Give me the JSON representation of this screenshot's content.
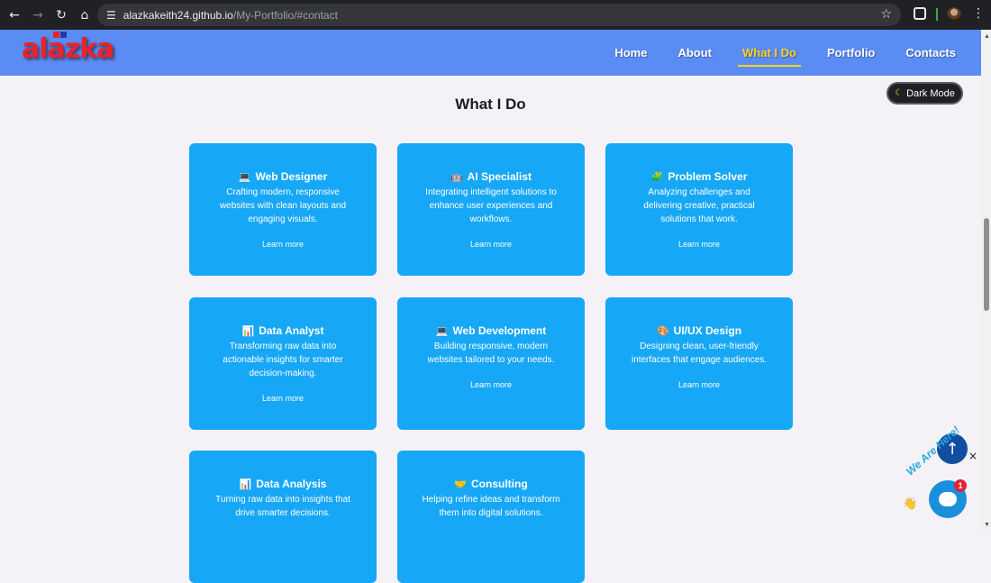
{
  "browser": {
    "url_host": "alazkakeith24.github.io",
    "url_path": "/My-Portfolio/#contact",
    "icons": [
      "back-icon",
      "forward-icon",
      "reload-icon",
      "home-icon",
      "site-settings-icon",
      "bookmark-star-icon",
      "extensions-icon",
      "profile-avatar",
      "menu-icon"
    ]
  },
  "header": {
    "logo_text": "alazka",
    "nav": [
      {
        "label": "Home"
      },
      {
        "label": "About"
      },
      {
        "label": "What I Do",
        "active": true
      },
      {
        "label": "Portfolio"
      },
      {
        "label": "Contacts"
      }
    ],
    "colors": {
      "bar": "#5b8cf4",
      "active": "#ffd21f",
      "logo": "#e8232b"
    }
  },
  "main": {
    "title": "What I Do",
    "dark_mode_label": "Dark Mode",
    "cards": [
      {
        "icon": "💻",
        "title": "Web Designer",
        "desc": "Crafting modern, responsive websites with clean layouts and engaging visuals.",
        "link": "Learn more"
      },
      {
        "icon": "🤖",
        "title": "AI Specialist",
        "desc": "Integrating intelligent solutions to enhance user experiences and workflows.",
        "link": "Learn more"
      },
      {
        "icon": "🧩",
        "title": "Problem Solver",
        "desc": "Analyzing challenges and delivering creative, practical solutions that work.",
        "link": "Learn more"
      },
      {
        "icon": "📊",
        "title": "Data Analyst",
        "desc": "Transforming raw data into actionable insights for smarter decision-making.",
        "link": "Learn more"
      },
      {
        "icon": "💻",
        "title": "Web Development",
        "desc": "Building responsive, modern websites tailored to your needs.",
        "link": "Learn more"
      },
      {
        "icon": "🎨",
        "title": "UI/UX Design",
        "desc": "Designing clean, user-friendly interfaces that engage audiences.",
        "link": "Learn more"
      },
      {
        "icon": "📊",
        "title": "Data Analysis",
        "desc": "Turning raw data into insights that drive smarter decisions.",
        "link": ""
      },
      {
        "icon": "🤝",
        "title": "Consulting",
        "desc": "Helping refine ideas and transform them into digital solutions.",
        "link": ""
      }
    ],
    "card_color": "#17a7f7"
  },
  "widgets": {
    "scroll_top_icon": "↑",
    "close_icon": "×",
    "chat_badge": "1",
    "chat_tagline": "We Are Here!",
    "wave_icon": "👋"
  }
}
